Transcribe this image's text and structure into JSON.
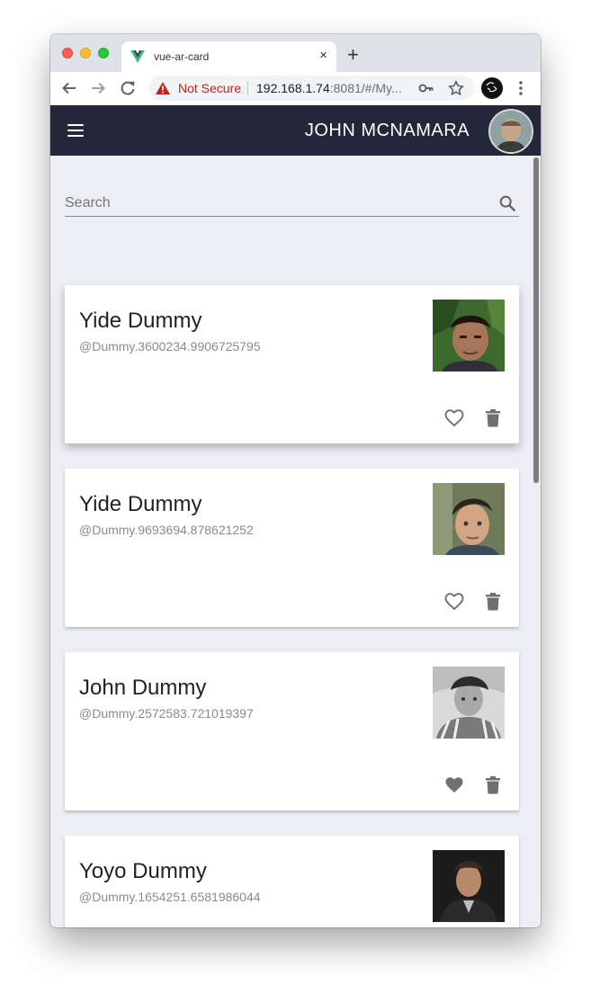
{
  "browser": {
    "tab_title": "vue-ar-card",
    "tab_close": "×",
    "new_tab": "+",
    "security_label": "Not Secure",
    "url_host": "192.168.1.74",
    "url_rest": ":8081/#/My...",
    "icons": [
      "back-arrow-icon",
      "forward-arrow-icon",
      "reload-icon",
      "warning-icon",
      "key-icon",
      "star-icon",
      "profile-icon",
      "more-vert-icon"
    ]
  },
  "appbar": {
    "user_name": "JOHN MCNAMARA",
    "background": "#24263a"
  },
  "search": {
    "placeholder": "Search"
  },
  "cards": [
    {
      "name": "Yide Dummy",
      "handle": "@Dummy.3600234.9906725795",
      "favorite": false,
      "raised": true
    },
    {
      "name": "Yide Dummy",
      "handle": "@Dummy.9693694.878621252",
      "favorite": false,
      "raised": false
    },
    {
      "name": "John Dummy",
      "handle": "@Dummy.2572583.721019397",
      "favorite": true,
      "raised": false
    },
    {
      "name": "Yoyo Dummy",
      "handle": "@Dummy.1654251.6581986044",
      "favorite": false,
      "raised": false
    }
  ],
  "colors": {
    "page_bg": "#edeef4",
    "card_bg": "#ffffff",
    "icon_gray": "#6f6f6f",
    "not_secure_red": "#c5221f"
  }
}
